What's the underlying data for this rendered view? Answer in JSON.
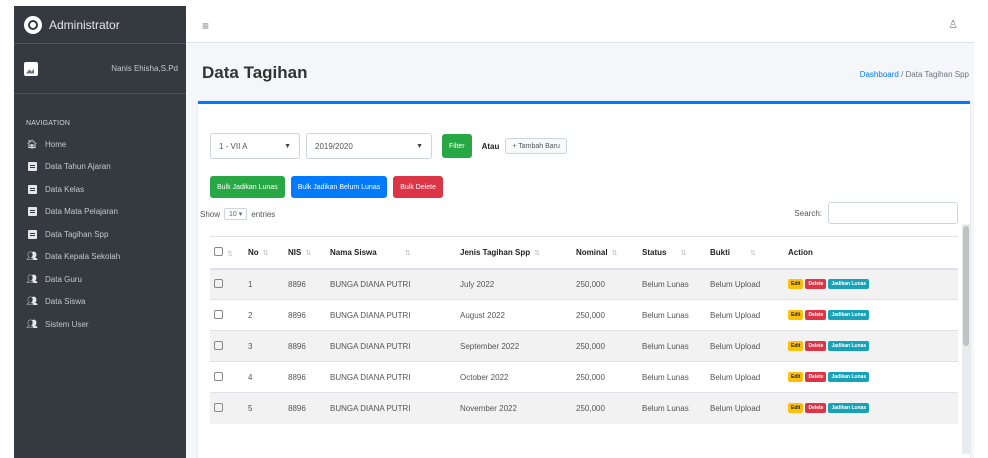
{
  "sidebar": {
    "brand": "Administrator",
    "user_name": "Nanis Ehisha,S.Pd",
    "nav_header": "NAVIGATION",
    "items": [
      {
        "label": "Home",
        "icon": "home-icon"
      },
      {
        "label": "Data Tahun Ajaran",
        "icon": "table-icon"
      },
      {
        "label": "Data Kelas",
        "icon": "table-icon"
      },
      {
        "label": "Data Mata Pelajaran",
        "icon": "table-icon"
      },
      {
        "label": "Data Tagihan Spp",
        "icon": "table-icon"
      },
      {
        "label": "Data Kepala Sekolah",
        "icon": "users-icon"
      },
      {
        "label": "Data Guru",
        "icon": "users-icon"
      },
      {
        "label": "Data Siswa",
        "icon": "users-icon"
      },
      {
        "label": "Sistem User",
        "icon": "users-icon"
      }
    ]
  },
  "header": {
    "menu_icon": "≡",
    "user_icon": "♙"
  },
  "page": {
    "title": "Data Tagihan",
    "breadcrumb_home": "Dashboard",
    "breadcrumb_sep": "/",
    "breadcrumb_current": "Data Tagihan Spp"
  },
  "filters": {
    "kelas": "1 - VII A",
    "tahun": "2019/2020",
    "filter_label": "Filter",
    "atau": "Atau",
    "tambah_label": "+ Tambah Baru"
  },
  "bulk": {
    "lunas": "Bulk Jadikan Lunas",
    "belum": "Bulk Jadikan Belum Lunas",
    "delete": "Bulk Delete"
  },
  "datatable": {
    "show_label": "Show",
    "entries_value": "10",
    "entries_label": "entries",
    "search_label": "Search:"
  },
  "table": {
    "headers": [
      "No",
      "NIS",
      "Nama Siswa",
      "Jenis Tagihan Spp",
      "Nominal",
      "Status",
      "Bukti",
      "Action"
    ],
    "rows": [
      {
        "no": "1",
        "nis": "8896",
        "nama": "BUNGA DIANA PUTRI",
        "jenis": "July 2022",
        "nominal": "250,000",
        "status": "Belum Lunas",
        "bukti": "Belum Upload"
      },
      {
        "no": "2",
        "nis": "8896",
        "nama": "BUNGA DIANA PUTRI",
        "jenis": "August 2022",
        "nominal": "250,000",
        "status": "Belum Lunas",
        "bukti": "Belum Upload"
      },
      {
        "no": "3",
        "nis": "8896",
        "nama": "BUNGA DIANA PUTRI",
        "jenis": "September 2022",
        "nominal": "250,000",
        "status": "Belum Lunas",
        "bukti": "Belum Upload"
      },
      {
        "no": "4",
        "nis": "8896",
        "nama": "BUNGA DIANA PUTRI",
        "jenis": "October 2022",
        "nominal": "250,000",
        "status": "Belum Lunas",
        "bukti": "Belum Upload"
      },
      {
        "no": "5",
        "nis": "8896",
        "nama": "BUNGA DIANA PUTRI",
        "jenis": "November 2022",
        "nominal": "250,000",
        "status": "Belum Lunas",
        "bukti": "Belum Upload"
      }
    ],
    "actions": {
      "edit": "Edit",
      "delete": "Delete",
      "jadikan": "Jadikan Lunas"
    }
  },
  "colors": {
    "sidebar": "#343a40",
    "primary": "#007bff",
    "success": "#28a745",
    "danger": "#dc3545",
    "warning": "#ffc107",
    "info": "#17a2b8"
  }
}
